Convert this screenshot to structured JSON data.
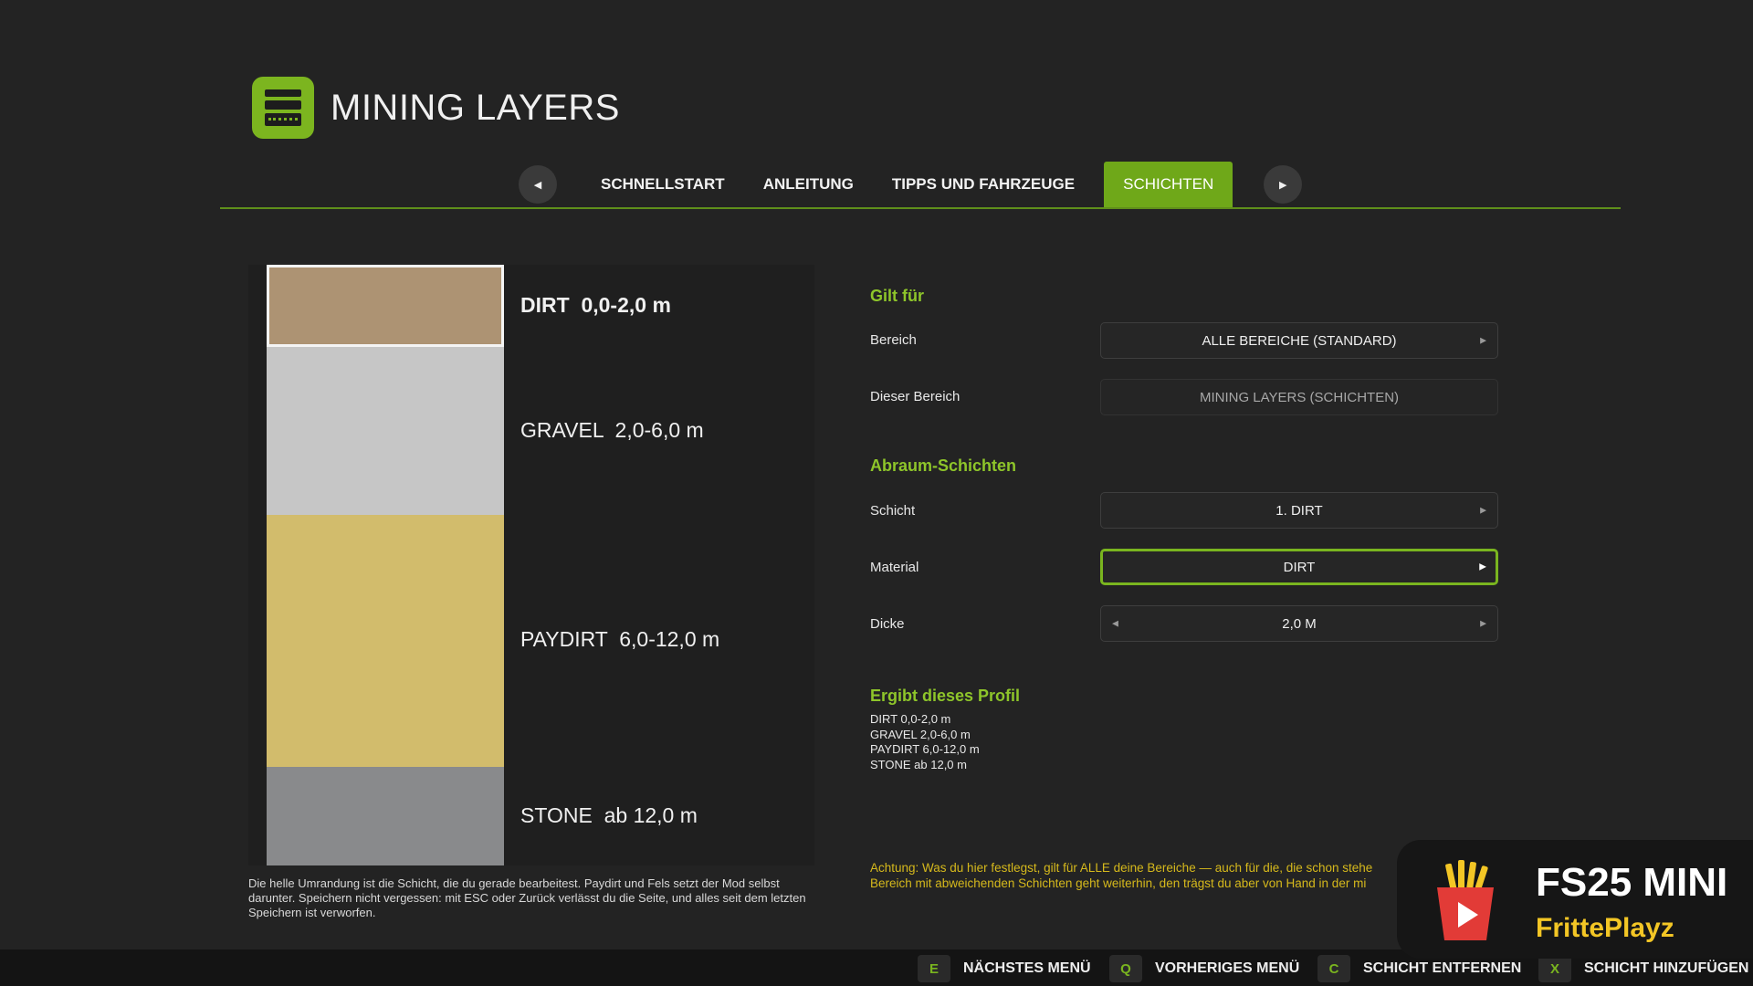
{
  "header": {
    "title": "MINING LAYERS",
    "logo_icon": "mining-layers-logo"
  },
  "tabs": {
    "prev_icon": "◀",
    "next_icon": "▶",
    "items": [
      {
        "label": "SCHNELLSTART",
        "active": false
      },
      {
        "label": "ANLEITUNG",
        "active": false
      },
      {
        "label": "TIPPS UND FAHRZEUGE",
        "active": false
      },
      {
        "label": "SCHICHTEN",
        "active": true
      }
    ]
  },
  "layers": [
    {
      "name": "DIRT",
      "range": "0,0-2,0 m",
      "color": "#ad9373",
      "selected": true
    },
    {
      "name": "GRAVEL",
      "range": "2,0-6,0 m",
      "color": "#c6c6c6",
      "selected": false
    },
    {
      "name": "PAYDIRT",
      "range": "6,0-12,0 m",
      "color": "#d2bc6c",
      "selected": false
    },
    {
      "name": "STONE",
      "range": "ab 12,0 m",
      "color": "#898a8c",
      "selected": false
    }
  ],
  "panel_note": "Die helle Umrandung ist die Schicht, die du gerade bearbeitest. Paydirt und Fels setzt der Mod selbst darunter. Speichern nicht vergessen: mit ESC oder Zurück verlässt du die Seite, und alles seit dem letzten Speichern ist verworfen.",
  "settings": {
    "applies_title": "Gilt für",
    "bereich": {
      "label": "Bereich",
      "value": "ALLE BEREICHE (STANDARD)"
    },
    "dieser_bereich": {
      "label": "Dieser Bereich",
      "value": "MINING LAYERS (SCHICHTEN)"
    },
    "overburden_title": "Abraum-Schichten",
    "schicht": {
      "label": "Schicht",
      "value": "1. DIRT"
    },
    "material": {
      "label": "Material",
      "value": "DIRT"
    },
    "dicke": {
      "label": "Dicke",
      "value": "2,0 M"
    },
    "arrow_right": "▶",
    "arrow_left": "◀"
  },
  "profile": {
    "title": "Ergibt dieses Profil",
    "lines": [
      "DIRT 0,0-2,0 m",
      "GRAVEL 2,0-6,0 m",
      "PAYDIRT 6,0-12,0 m",
      "STONE ab 12,0 m"
    ]
  },
  "warning": {
    "line1": "Achtung: Was du hier festlegst, gilt für ALLE deine Bereiche — auch für die, die schon stehe",
    "line2": "Bereich mit abweichenden Schichten geht weiterhin, den trägst du aber von Hand in der mi"
  },
  "overlay": {
    "title": "FS25 MINI",
    "subtitle": "FrittePlayz",
    "icon": "fries-play-icon"
  },
  "footer": {
    "hints": [
      {
        "key": "E",
        "label": "NÄCHSTES MENÜ"
      },
      {
        "key": "Q",
        "label": "VORHERIGES MENÜ"
      },
      {
        "key": "C",
        "label": "SCHICHT ENTFERNEN"
      },
      {
        "key": "X",
        "label": "SCHICHT HINZUFÜGEN"
      }
    ]
  }
}
